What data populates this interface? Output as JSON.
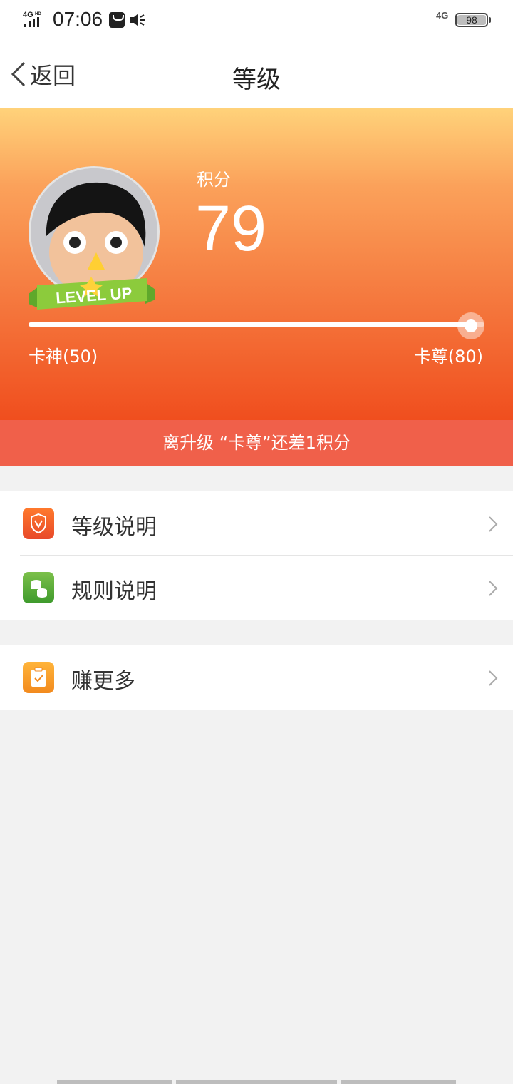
{
  "status_bar": {
    "network_left": "4G HD",
    "time": "07:06",
    "network_right": "4G",
    "battery": "98"
  },
  "nav": {
    "back_label": "返回",
    "title": "等级"
  },
  "hero": {
    "points_label": "积分",
    "points_value": "79",
    "avatar_badge": "LEVEL UP",
    "progress": 0.97,
    "level_current": "卡神(50)",
    "level_next": "卡尊(80)",
    "colors": {
      "gradient_top": "#ffd27a",
      "gradient_bottom": "#f04e1e"
    }
  },
  "upgrade_banner": "离升级 “卡尊”还差1积分",
  "menu": {
    "group1": [
      {
        "label": "等级说明",
        "icon": "shield-v-icon"
      },
      {
        "label": "规则说明",
        "icon": "coins-icon"
      }
    ],
    "group2": [
      {
        "label": "赚更多",
        "icon": "clipboard-check-icon"
      }
    ]
  }
}
